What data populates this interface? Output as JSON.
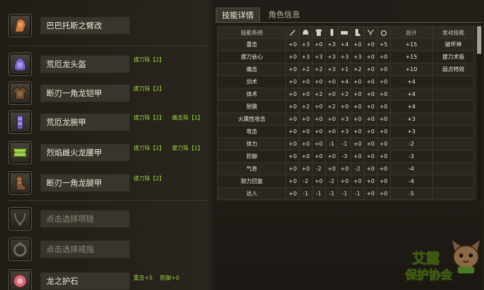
{
  "equipment": [
    {
      "name": "巴巴托斯之臂改",
      "icon": "gauntlet-icon",
      "jewels": []
    },
    {
      "name": "荒厄龙头盔",
      "icon": "helmet-icon",
      "jewels": [
        "拔刀珠【2】"
      ]
    },
    {
      "name": "断刃一角龙铠甲",
      "icon": "chest-armor-icon",
      "jewels": [
        "拔刀珠【2】"
      ]
    },
    {
      "name": "荒厄龙腕甲",
      "icon": "arm-armor-icon",
      "jewels": [
        "拔刀珠【2】",
        "痛击珠【1】"
      ]
    },
    {
      "name": "烈焰雌火龙腰甲",
      "icon": "waist-armor-icon",
      "jewels": [
        "拔刀珠【2】",
        "拔刀珠【1】"
      ]
    },
    {
      "name": "断刃一角龙腿甲",
      "icon": "leg-armor-icon",
      "jewels": [
        "拔刀珠【2】"
      ]
    },
    {
      "name": "点击选择项链",
      "icon": "necklace-slot-icon",
      "jewels": [],
      "placeholder": true
    },
    {
      "name": "点击选择戒指",
      "icon": "ring-slot-icon",
      "jewels": [],
      "placeholder": true
    },
    {
      "name": "龙之护石",
      "icon": "talisman-icon",
      "jewels": [
        "重击+5",
        "防御+0"
      ]
    }
  ],
  "tabs": [
    {
      "label": "技能详情",
      "active": true
    },
    {
      "label": "角色信息",
      "active": false
    }
  ],
  "table": {
    "header_skill": "技能系统",
    "header_icons": [
      "weapon-icon",
      "helmet-icon",
      "chest-armor-icon",
      "arm-armor-icon",
      "waist-armor-icon",
      "leg-armor-icon",
      "necklace-icon",
      "ring-icon"
    ],
    "header_total": "总计",
    "header_active": "发动技能",
    "rows": [
      {
        "skill": "重击",
        "values": [
          "+0",
          "+3",
          "+0",
          "+3",
          "+4",
          "+0",
          "+0",
          "+5"
        ],
        "total": "+15",
        "active": "破坏神"
      },
      {
        "skill": "拔刀会心",
        "values": [
          "+0",
          "+3",
          "+3",
          "+3",
          "+3",
          "+3",
          "+0",
          "+0"
        ],
        "total": "+15",
        "active": "拔刀术极"
      },
      {
        "skill": "痛击",
        "values": [
          "+0",
          "+2",
          "+2",
          "+3",
          "+1",
          "+2",
          "+0",
          "+0"
        ],
        "total": "+10",
        "active": "弱点特效"
      },
      {
        "skill": "剑术",
        "values": [
          "+0",
          "+0",
          "+0",
          "+0",
          "+4",
          "+0",
          "+0",
          "+0"
        ],
        "total": "+4",
        "active": ""
      },
      {
        "skill": "体术",
        "values": [
          "+0",
          "+0",
          "+2",
          "+0",
          "+2",
          "+0",
          "+0",
          "+0"
        ],
        "total": "+4",
        "active": ""
      },
      {
        "skill": "耐震",
        "values": [
          "+0",
          "+2",
          "+0",
          "+2",
          "+0",
          "+0",
          "+0",
          "+0"
        ],
        "total": "+4",
        "active": ""
      },
      {
        "skill": "火属性攻击",
        "values": [
          "+0",
          "+0",
          "+0",
          "+0",
          "+3",
          "+0",
          "+0",
          "+0"
        ],
        "total": "+3",
        "active": ""
      },
      {
        "skill": "攻击",
        "values": [
          "+0",
          "+0",
          "+0",
          "+0",
          "+3",
          "+0",
          "+0",
          "+0"
        ],
        "total": "+3",
        "active": ""
      },
      {
        "skill": "体力",
        "values": [
          "+0",
          "+0",
          "+0",
          "-1",
          "-1",
          "+0",
          "+0",
          "+0"
        ],
        "total": "-2",
        "active": ""
      },
      {
        "skill": "防御",
        "values": [
          "+0",
          "+0",
          "+0",
          "+0",
          "-3",
          "+0",
          "+0",
          "+0"
        ],
        "total": "-3",
        "active": ""
      },
      {
        "skill": "气息",
        "values": [
          "+0",
          "+0",
          "-2",
          "+0",
          "+0",
          "-2",
          "+0",
          "+0"
        ],
        "total": "-4",
        "active": ""
      },
      {
        "skill": "耐力回复",
        "values": [
          "+0",
          "-2",
          "+0",
          "-2",
          "+0",
          "+0",
          "+0",
          "+0"
        ],
        "total": "-4",
        "active": ""
      },
      {
        "skill": "达人",
        "values": [
          "+0",
          "-1",
          "-1",
          "-1",
          "-1",
          "-1",
          "+0",
          "+0"
        ],
        "total": "-5",
        "active": ""
      }
    ]
  },
  "watermark": {
    "line1": "艾露",
    "line2": "保护协会"
  },
  "colors": {
    "jewel_text": "#9bd13e",
    "panel": "#3a352c",
    "border": "#5c5446"
  }
}
